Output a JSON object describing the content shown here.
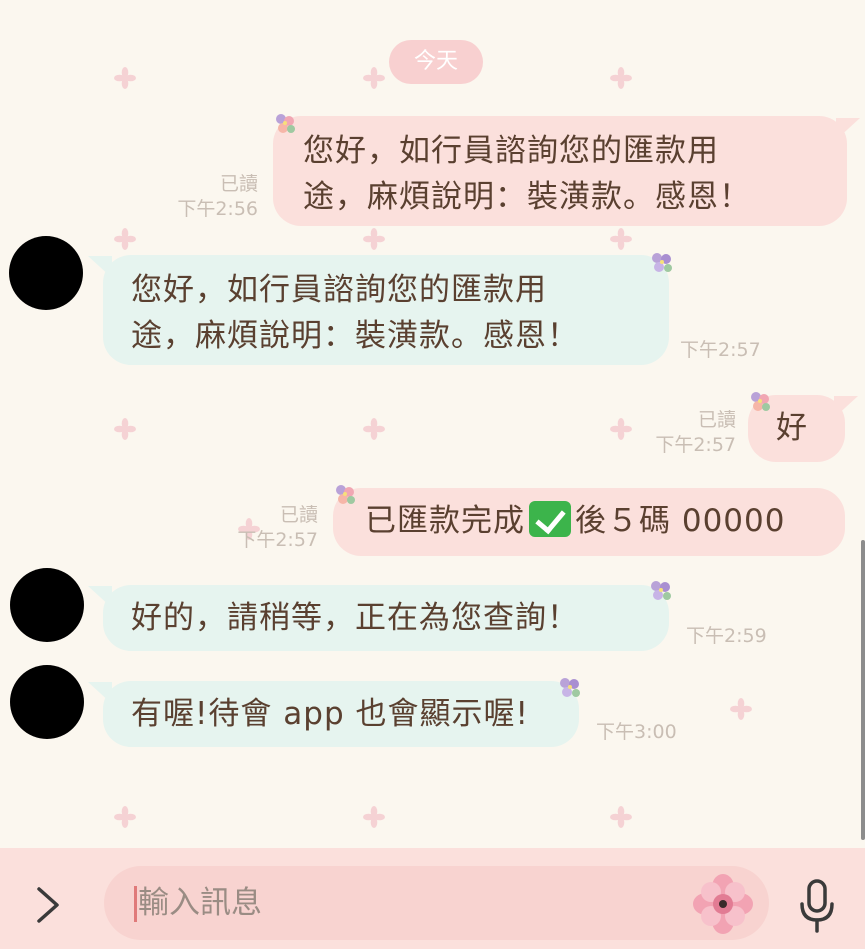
{
  "date_divider": "今天",
  "messages": [
    {
      "direction": "out",
      "text": "您好，如行員諮詢您的匯款用\n途，麻煩說明：裝潢款。感恩！",
      "read": "已讀",
      "time": "下午2:56"
    },
    {
      "direction": "in",
      "text": "您好，如行員諮詢您的匯款用\n途，麻煩說明：裝潢款。感恩！",
      "time": "下午2:57"
    },
    {
      "direction": "out",
      "text": "好",
      "read": "已讀",
      "time": "下午2:57"
    },
    {
      "direction": "out",
      "text_before": "已匯款完成",
      "text_after": "後５碼 00000",
      "read": "已讀",
      "time": "下午2:57"
    },
    {
      "direction": "in",
      "text": "好的，請稍等，正在為您查詢！",
      "time": "下午2:59"
    },
    {
      "direction": "in",
      "text": "有喔!待會 app 也會顯示喔!",
      "time": "下午3:00"
    }
  ],
  "input": {
    "placeholder": "輸入訊息"
  },
  "colors": {
    "background": "#fbf7ef",
    "outgoing_bubble": "#fbe0dc",
    "incoming_bubble": "#e6f4ef",
    "text": "#5a4030",
    "meta_text": "#c9beb4",
    "input_bar": "#fbe0dc"
  },
  "icons": {
    "expand": "chevron-right-icon",
    "sticker": "flower-sticker-icon",
    "voice": "microphone-icon",
    "check": "check-mark-button-emoji"
  }
}
